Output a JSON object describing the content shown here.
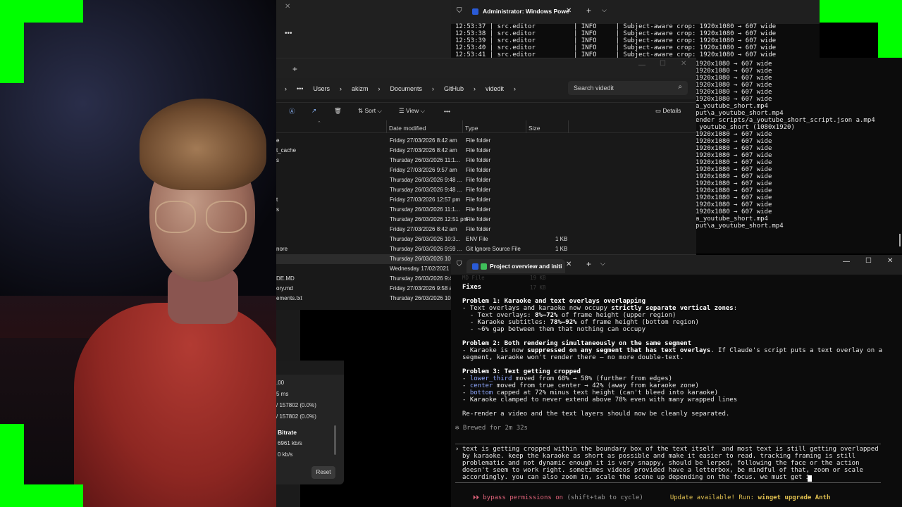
{
  "explorer": {
    "breadcrumb": [
      "Users",
      "akizm",
      "Documents",
      "GitHub",
      "videdit"
    ],
    "search_placeholder": "Search videdit",
    "toolbar": {
      "sort": "Sort",
      "view": "View",
      "details": "Details"
    },
    "columns": {
      "date": "Date modified",
      "type": "Type",
      "size": "Size"
    },
    "rows": [
      {
        "name": "e",
        "date": "Friday 27/03/2026 8:42 am",
        "type": "File folder",
        "size": ""
      },
      {
        "name": "t_cache",
        "date": "Friday 27/03/2026 8:42 am",
        "type": "File folder",
        "size": ""
      },
      {
        "name": "s",
        "date": "Thursday 26/03/2026 11:1...",
        "type": "File folder",
        "size": ""
      },
      {
        "name": "",
        "date": "Friday 27/03/2026 9:57 am",
        "type": "File folder",
        "size": ""
      },
      {
        "name": "",
        "date": "Thursday 26/03/2026 9:48 ...",
        "type": "File folder",
        "size": ""
      },
      {
        "name": "",
        "date": "Thursday 26/03/2026 9:48 ...",
        "type": "File folder",
        "size": ""
      },
      {
        "name": "t",
        "date": "Friday 27/03/2026 12:57 pm",
        "type": "File folder",
        "size": ""
      },
      {
        "name": "s",
        "date": "Thursday 26/03/2026 11:1...",
        "type": "File folder",
        "size": ""
      },
      {
        "name": "",
        "date": "Thursday 26/03/2026 12:51 pm",
        "type": "File folder",
        "size": ""
      },
      {
        "name": "",
        "date": "Friday 27/03/2026 8:42 am",
        "type": "File folder",
        "size": ""
      },
      {
        "name": "",
        "date": "Thursday 26/03/2026 10:3...",
        "type": "ENV File",
        "size": "1 KB"
      },
      {
        "name": "nore",
        "date": "Thursday 26/03/2026 9:59 ...",
        "type": "Git Ignore Source File",
        "size": "1 KB"
      },
      {
        "name": "",
        "date": "Thursday 26/03/2026 10:...",
        "type": "",
        "size": ""
      },
      {
        "name": "",
        "date": "Wednesday 17/02/2021 2...",
        "type": "",
        "size": ""
      },
      {
        "name": "DE.MD",
        "date": "Thursday 26/03/2026 9:4...",
        "type": "",
        "size": ""
      },
      {
        "name": "ory.md",
        "date": "Friday 27/03/2026 9:58 a...",
        "type": "",
        "size": ""
      },
      {
        "name": "ements.txt",
        "date": "Thursday 26/03/2026 10:3...",
        "type": "",
        "size": ""
      }
    ]
  },
  "stats_panel": {
    "lines": [
      ".00",
      "5 ms",
      "/ 157802 (0.0%)",
      "/ 157802 (0.0%)"
    ],
    "bitrate_label": "Bitrate",
    "bitrate_values": [
      "6961 kb/s",
      "0 kb/s"
    ],
    "reset_label": "Reset"
  },
  "terminal_top": {
    "tab_title": "Administrator: Windows Powe",
    "log_lines": [
      "12:53:37 | src.editor          | INFO     | Subject-aware crop: 1920x1080 → 607 wide",
      "12:53:38 | src.editor          | INFO     | Subject-aware crop: 1920x1080 → 607 wide",
      "12:53:39 | src.editor          | INFO     | Subject-aware crop: 1920x1080 → 607 wide",
      "12:53:40 | src.editor          | INFO     | Subject-aware crop: 1920x1080 → 607 wide",
      "12:53:41 | src.editor          | INFO     | Subject-aware crop: 1920x1080 → 607 wide"
    ],
    "right_lines": [
      "1920x1080 → 607 wide",
      "1920x1080 → 607 wide",
      "1920x1080 → 607 wide",
      "1920x1080 → 607 wide",
      "1920x1080 → 607 wide",
      "1920x1080 → 607 wide",
      "a_youtube_short.mp4",
      "put\\a_youtube_short.mp4",
      "",
      "ender scripts/a_youtube_short_script.json a.mp4",
      " youtube_short (1080x1920)",
      "1920x1080 → 607 wide",
      "1920x1080 → 607 wide",
      "1920x1080 → 607 wide",
      "1920x1080 → 607 wide",
      "1920x1080 → 607 wide",
      "1920x1080 → 607 wide",
      "1920x1080 → 607 wide",
      "1920x1080 → 607 wide",
      "1920x1080 → 607 wide",
      "1920x1080 → 607 wide",
      "1920x1080 → 607 wide",
      "1920x1080 → 607 wide",
      "a_youtube_short.mp4",
      "put\\a_youtube_short.mp4"
    ]
  },
  "terminal_claude": {
    "tab_title": "Project overview and initi",
    "faded_rows": [
      {
        "type": "MD File",
        "size": "19 KB"
      },
      {
        "type": "",
        "size": "17 KB"
      }
    ],
    "heading": "Fixes",
    "problem1_title": "Problem 1: Karaoke and text overlays overlapping",
    "p1_line1_a": "- Text overlays and karaoke now occupy ",
    "p1_line1_b": "strictly separate vertical zones",
    "p1_line1_c": ":",
    "p1_line2_a": "  - Text overlays: ",
    "p1_line2_b": "8%–72%",
    "p1_line2_c": " of frame height (upper region)",
    "p1_line3_a": "  - Karaoke subtitles: ",
    "p1_line3_b": "78%–92%",
    "p1_line3_c": " of frame height (bottom region)",
    "p1_line4": "  - ~6% gap between them that nothing can occupy",
    "problem2_title": "Problem 2: Both rendering simultaneously on the same segment",
    "p2_line1_a": "- Karaoke is now ",
    "p2_line1_b": "suppressed on any segment that has text overlays",
    "p2_line1_c": ". If Claude's script puts a text overlay on a",
    "p2_line2": "segment, karaoke won't render there — no more double-text.",
    "problem3_title": "Problem 3: Text getting cropped",
    "p3_line1_a": "- ",
    "p3_line1_b": "lower_third",
    "p3_line1_c": " moved from 68% → 58% (further from edges)",
    "p3_line2_a": "- ",
    "p3_line2_b": "center",
    "p3_line2_c": " moved from true center → 42% (away from karaoke zone)",
    "p3_line3_a": "- ",
    "p3_line3_b": "bottom",
    "p3_line3_c": " capped at 72% minus text height (can't bleed into karaoke)",
    "p3_line4": "- Karaoke clamped to never extend above 78% even with many wrapped lines",
    "rerender": "Re-render a video and the text layers should now be cleanly separated.",
    "brewed": "✻ Brewed for 2m 32s",
    "prompt_lines": [
      "text is getting cropped within the boundary box of the text itself  and most text is still getting overlapped",
      "by karaoke. keep the karaoke as short as possible and make it easier to read. tracking framing is still",
      "problematic and not dynamic enough it is very snappy, should be lerped, following the face or the action",
      "doesn't seem to work right. sometimes videos provided have a letterbox, be mindful of that, zoom or scale",
      "accordingly. you can also zoom in, scale the scene up depending on the focus. we must get i"
    ],
    "status_left": "⏵⏵ bypass permissions on",
    "status_hint": " (shift+tab to cycle)",
    "status_right_a": "Update available! Run: ",
    "status_right_b": "winget upgrade Anth"
  },
  "colors": {
    "green_screen": "#00ff00",
    "claude_accent": "#e0637a",
    "update": "#e0c050"
  }
}
